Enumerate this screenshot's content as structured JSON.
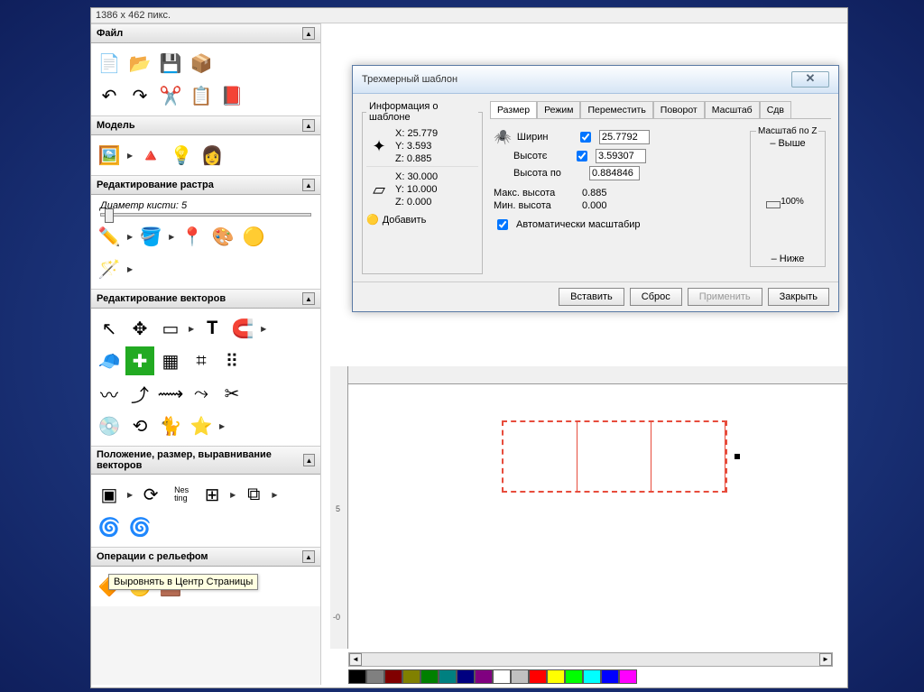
{
  "status": "1386 x 462 пикс.",
  "panels": {
    "file": "Файл",
    "model": "Модель",
    "raster": "Редактирование растра",
    "brush": "Диаметр кисти:",
    "brush_val": "5",
    "vectors": "Редактирование векторов",
    "position": "Положение, размер, выравнивание векторов",
    "relief": "Операции с рельефом"
  },
  "tooltip": "Выровнять в Центр Страницы",
  "dialog": {
    "title": "Трехмерный шаблон",
    "info_group": "Информация о шаблоне",
    "xyz1": {
      "x": "X:  25.779",
      "y": "Y:  3.593",
      "z": "Z:  0.885"
    },
    "xyz2": {
      "x": "X:  30.000",
      "y": "Y:  10.000",
      "z": "Z:  0.000"
    },
    "add": "Добавить",
    "tabs": [
      "Размер",
      "Режим",
      "Переместить",
      "Поворот",
      "Масштаб",
      "Сдв"
    ],
    "width_label": "Ширин",
    "height_label": "Высотє",
    "height_by_label": "Высота по",
    "width_val": "25.7792",
    "height_val": "3.59307",
    "heightby_val": "0.884846",
    "max_h_label": "Макс. высота",
    "max_h_val": "0.885",
    "min_h_label": "Мин. высота",
    "min_h_val": "0.000",
    "auto_scale": "Автоматически масштабир",
    "zscale": "Масштаб по Z",
    "higher": "Выше",
    "pct": "100%",
    "lower": "Ниже",
    "buttons": {
      "insert": "Вставить",
      "reset": "Сброс",
      "apply": "Применить",
      "close": "Закрыть"
    }
  },
  "ruler": {
    "tick_neg": "-0",
    "tick_5": "5"
  },
  "colors": [
    "#000",
    "#808080",
    "#800000",
    "#808000",
    "#008000",
    "#008080",
    "#000080",
    "#800080",
    "#fff",
    "#c0c0c0",
    "#f00",
    "#ff0",
    "#0f0",
    "#0ff",
    "#00f",
    "#f0f"
  ]
}
